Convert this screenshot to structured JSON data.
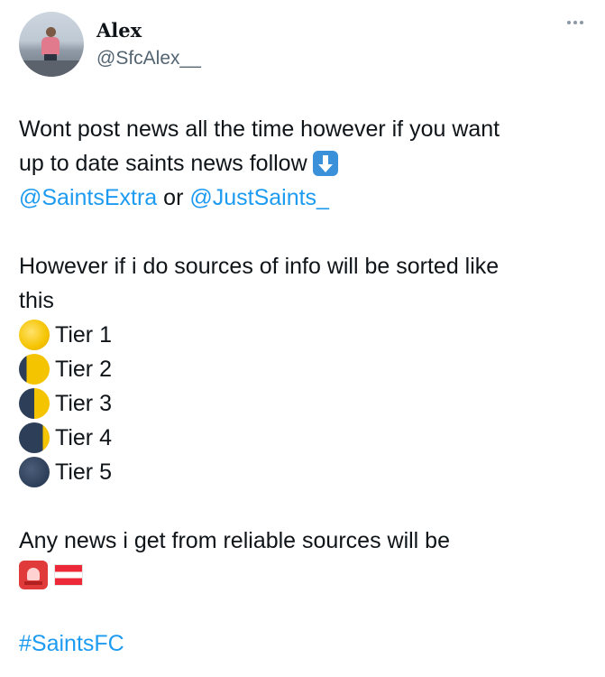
{
  "tweet": {
    "author": {
      "name": "Alex",
      "handle": "@SfcAlex__"
    },
    "lines": {
      "l1": "Wont post news all the time however if you want",
      "l2": "up to date saints news follow",
      "mention1": "@SaintsExtra",
      "or": " or ",
      "mention2": "@JustSaints_",
      "l4": "However if i do sources of info will be sorted like",
      "l5": "this",
      "tiers": [
        "Tier 1",
        "Tier 2",
        "Tier 3",
        "Tier 4",
        "Tier 5"
      ],
      "l6": "Any news i get from reliable sources will be",
      "hashtag": "#SaintsFC"
    },
    "icons": {
      "follow_arrow": "down-arrow-icon",
      "tier_icons": [
        "full-moon-icon",
        "waning-gibbous-moon-icon",
        "last-quarter-moon-icon",
        "waning-crescent-moon-icon",
        "new-moon-icon"
      ],
      "reliable": [
        "police-siren-icon",
        "austria-flag-icon"
      ]
    }
  },
  "colors": {
    "text": "#0f1419",
    "secondary": "#536471",
    "link": "#1d9bf0"
  }
}
